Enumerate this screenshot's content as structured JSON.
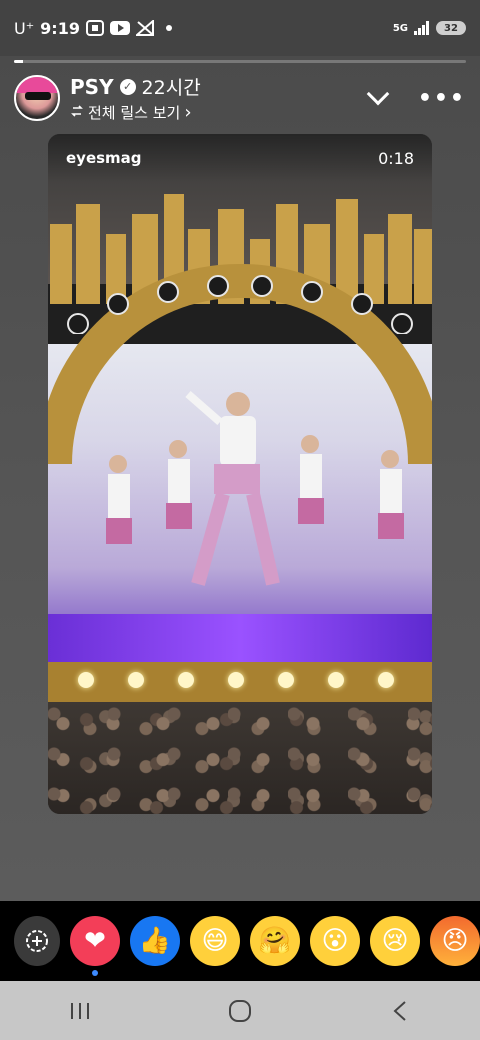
{
  "status_bar": {
    "carrier": "U⁺",
    "time": "9:19",
    "network": "5G",
    "battery": "32"
  },
  "story": {
    "progress_fraction": 0.02,
    "username": "PSY",
    "time_ago": "22시간",
    "reels_link": "전체 릴스 보기",
    "reels_link_chevron": "›"
  },
  "media": {
    "source_label": "eyesmag",
    "duration": "0:18"
  },
  "reactions": [
    {
      "name": "heart",
      "glyph": "❤"
    },
    {
      "name": "like",
      "glyph": "👍"
    },
    {
      "name": "haha",
      "glyph": "😄"
    },
    {
      "name": "care",
      "glyph": "🤗"
    },
    {
      "name": "wow",
      "glyph": "😮"
    },
    {
      "name": "sad",
      "glyph": "😢"
    },
    {
      "name": "angry",
      "glyph": "😠"
    }
  ],
  "colors": {
    "heart": "#f33e58",
    "like": "#1877f2",
    "emoji_face": "#ffd03b",
    "stage_gold": "#b8913c",
    "stage_purple": "#7a3ee0"
  }
}
